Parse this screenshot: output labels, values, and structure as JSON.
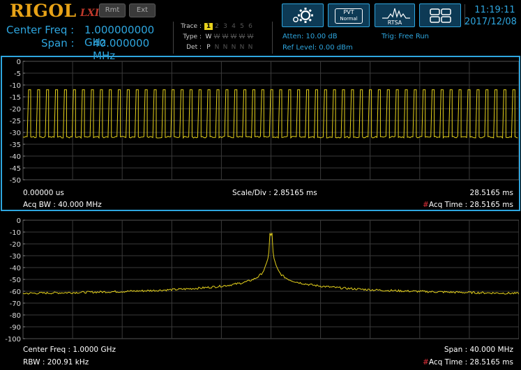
{
  "header": {
    "brand": "RIGOL",
    "brand_sub": "LXI",
    "rmt_label": "Rmt",
    "ext_label": "Ext",
    "center_freq_label": "Center Freq :",
    "center_freq_value": "1.000000000 GHz",
    "span_label": "Span :",
    "span_value": "40.000000 MHz",
    "trace": {
      "trace_label": "Trace :",
      "type_label": "Type :",
      "det_label": "Det :",
      "numbers": [
        "1",
        "2",
        "3",
        "4",
        "5",
        "6"
      ],
      "types": [
        "W",
        "W",
        "W",
        "W",
        "W",
        "W"
      ],
      "dets": [
        "P",
        "N",
        "N",
        "N",
        "N",
        "N"
      ]
    },
    "atten": "Atten: 10.00 dB",
    "ref_level": "Ref Level: 0.00 dBm",
    "trig": "Trig: Free Run",
    "pvt_label_top": "PVT",
    "pvt_label_bottom": "Normal",
    "rtsa_label": "RTSA",
    "time": "11:19:11",
    "date": "2017/12/08",
    "icons": [
      "gear-icon",
      "pvt-icon",
      "rtsa-icon",
      "layout-icon"
    ],
    "accent_color": "#2ea6df",
    "brand_color": "#e8a317"
  },
  "panel1": {
    "y_ticks": [
      "0",
      "-5",
      "-10",
      "-15",
      "-20",
      "-25",
      "-30",
      "-35",
      "-40",
      "-45",
      "-50"
    ],
    "start_time": "0.00000 us",
    "scale_div": "Scale/Div : 2.85165 ms",
    "end_time": "28.5165 ms",
    "acq_bw": "Acq BW : 40.000 MHz",
    "acq_time_hash": "#",
    "acq_time": "Acq Time : 28.5165 ms"
  },
  "panel2": {
    "y_ticks": [
      "0",
      "-10",
      "-20",
      "-30",
      "-40",
      "-50",
      "-60",
      "-70",
      "-80",
      "-90",
      "-100"
    ],
    "center_freq": "Center Freq : 1.0000 GHz",
    "span": "Span : 40.000 MHz",
    "rbw": "RBW : 200.91 kHz",
    "acq_time_hash": "#",
    "acq_time": "Acq Time : 28.5165 ms"
  },
  "chart_data": [
    {
      "type": "line",
      "ylim": [
        -50,
        0
      ],
      "xlim": [
        0,
        28.5165
      ],
      "x_unit": "ms",
      "y_unit": "dBm",
      "grid": true,
      "trace_color": "#e6d21c",
      "pulse_count": 55,
      "high_level": -12,
      "low_level": -32
    },
    {
      "type": "line",
      "ylim": [
        -100,
        0
      ],
      "xlim": [
        980,
        1020
      ],
      "x_unit": "MHz",
      "y_unit": "dBm",
      "grid": true,
      "trace_color": "#e6d21c",
      "peak_x": 1000,
      "peak_y": -13,
      "edge_level": -62
    }
  ]
}
